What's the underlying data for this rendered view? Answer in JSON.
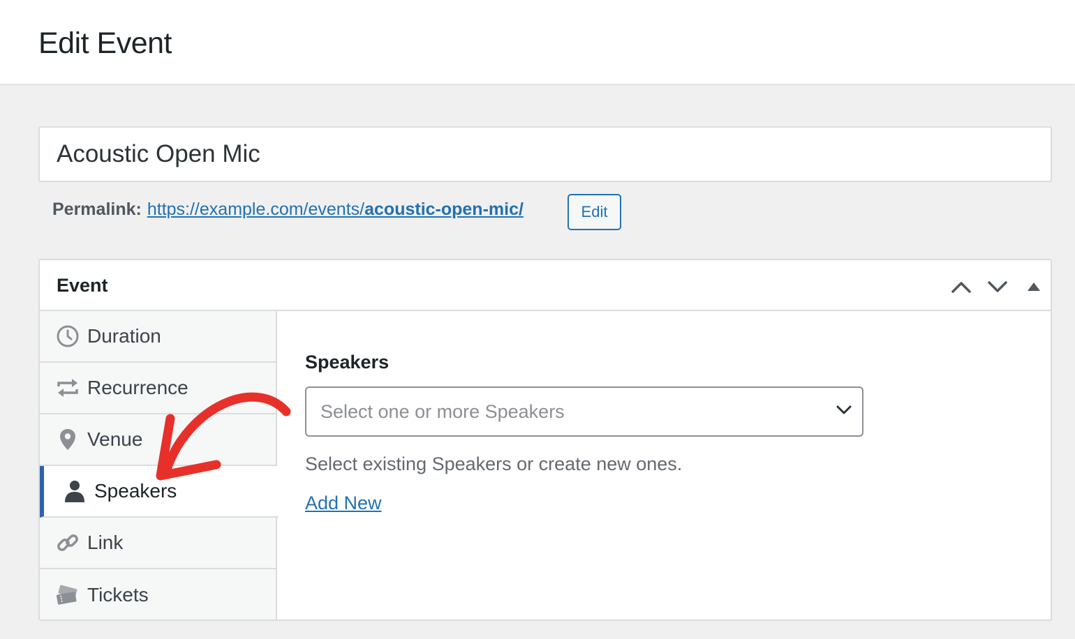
{
  "page": {
    "title": "Edit Event"
  },
  "post": {
    "title_value": "Acoustic Open Mic",
    "permalink_label": "Permalink:",
    "permalink_base": "https://example.com/events/",
    "permalink_slug": "acoustic-open-mic/",
    "permalink_edit_label": "Edit"
  },
  "metabox": {
    "title": "Event",
    "controls": [
      "move-up-icon",
      "move-down-icon",
      "toggle-panel-icon"
    ],
    "tabs": [
      {
        "label": "Duration",
        "icon": "clock-icon",
        "active": false
      },
      {
        "label": "Recurrence",
        "icon": "repeat-icon",
        "active": false
      },
      {
        "label": "Venue",
        "icon": "location-pin-icon",
        "active": false
      },
      {
        "label": "Speakers",
        "icon": "person-icon",
        "active": true
      },
      {
        "label": "Link",
        "icon": "link-icon",
        "active": false
      },
      {
        "label": "Tickets",
        "icon": "tickets-icon",
        "active": false
      }
    ],
    "panel": {
      "label": "Speakers",
      "select_placeholder": "Select one or more Speakers",
      "help_text": "Select existing Speakers or create new ones.",
      "add_new_label": "Add New"
    }
  },
  "colors": {
    "accent": "#2271b1",
    "active_tab_border": "#2c62b2",
    "annotation_arrow": "#e8302a"
  }
}
